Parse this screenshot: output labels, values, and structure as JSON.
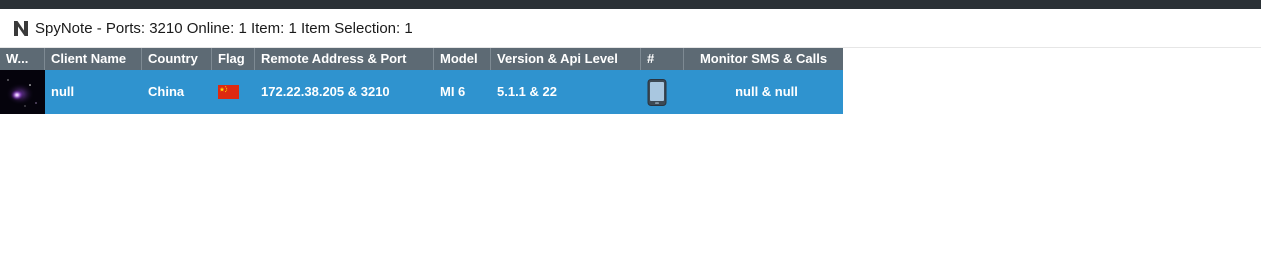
{
  "window": {
    "app_icon": "spynote-n-logo-icon",
    "title": "SpyNote - Ports: 3210 Online: 1 Item: 1 Item Selection: 1"
  },
  "table": {
    "columns": [
      "W...",
      "Client Name",
      "Country",
      "Flag",
      "Remote Address & Port",
      "Model",
      "Version & Api Level",
      "#",
      "Monitor SMS & Calls"
    ],
    "rows": [
      {
        "wallpaper": "galaxy-wallpaper-thumbnail",
        "client_name": "null",
        "country": "China",
        "flag": "china-flag-icon",
        "remote_address": "172.22.38.205 & 3210",
        "model": "MI 6",
        "version": "5.1.1 & 22",
        "device": "phone-icon",
        "monitor": "null & null",
        "selected": true
      }
    ]
  },
  "colors": {
    "header_bg": "#5d6a74",
    "selected_row_bg": "#2f93cf",
    "top_strip": "#2b3136",
    "flag_red": "#de2910",
    "flag_yellow": "#ffde00"
  }
}
